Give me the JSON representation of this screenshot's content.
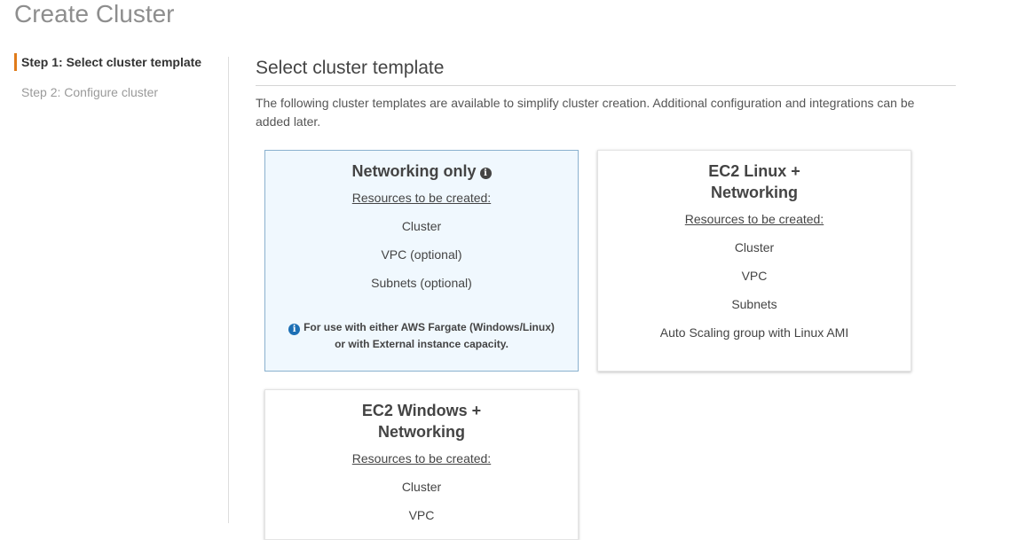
{
  "page": {
    "title": "Create Cluster"
  },
  "steps": [
    {
      "label": "Step 1: Select cluster template"
    },
    {
      "label": "Step 2: Configure cluster"
    }
  ],
  "section": {
    "title": "Select cluster template",
    "description": "The following cluster templates are available to simplify cluster creation. Additional configuration and integrations can be added later."
  },
  "templates": [
    {
      "title": "Networking only",
      "selected": true,
      "resources_heading": "Resources to be created:",
      "resources": [
        "Cluster",
        "VPC (optional)",
        "Subnets (optional)"
      ],
      "note_line1": "For use with either AWS Fargate (Windows/Linux)",
      "note_line2": "or with External instance capacity."
    },
    {
      "title_line1": "EC2 Linux +",
      "title_line2": "Networking",
      "selected": false,
      "resources_heading": "Resources to be created:",
      "resources": [
        "Cluster",
        "VPC",
        "Subnets",
        "Auto Scaling group with Linux AMI"
      ]
    },
    {
      "title_line1": "EC2 Windows +",
      "title_line2": "Networking",
      "selected": false,
      "resources_heading": "Resources to be created:",
      "resources": [
        "Cluster",
        "VPC"
      ]
    }
  ],
  "colors": {
    "active_step_accent": "#e07b1a",
    "selected_card_bg": "#f0f8fe",
    "selected_card_border": "#8ab1cf",
    "info_note_icon": "#1c6fb5"
  },
  "icons": {
    "title_info": "info-icon",
    "note_info": "info-circle-icon"
  }
}
